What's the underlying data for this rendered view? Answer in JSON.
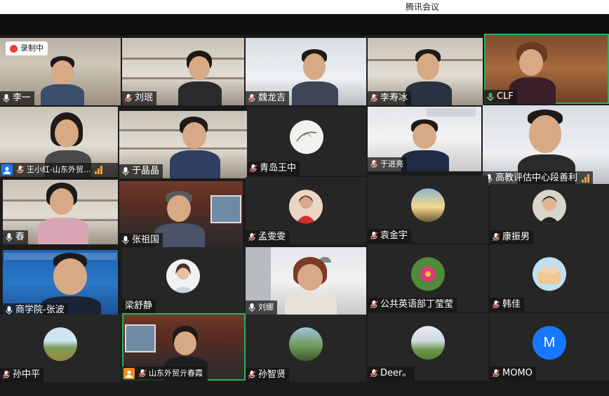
{
  "window": {
    "title": "腾讯会议"
  },
  "recording": {
    "label": "录制中"
  },
  "colors": {
    "active_border": "#2bb25a",
    "avatar_blue": "#1677ff",
    "record_red": "#e8403a",
    "signal": "#f0a030"
  },
  "participants": [
    {
      "name": "李一",
      "mic": "on"
    },
    {
      "name": "刘珉",
      "mic": "muted"
    },
    {
      "name": "魏龙吉",
      "mic": "muted"
    },
    {
      "name": "李寿冰",
      "mic": "muted"
    },
    {
      "name": "CLF",
      "mic": "on"
    },
    {
      "name": "王小红-山东外贸...",
      "mic": "muted"
    },
    {
      "name": "于晶晶",
      "mic": "on"
    },
    {
      "name": "青岛王中",
      "mic": "muted"
    },
    {
      "name": "于进亮",
      "mic": "muted"
    },
    {
      "name": "高教评估中心段善利",
      "mic": "on"
    },
    {
      "name": "春",
      "mic": "on"
    },
    {
      "name": "张祖国",
      "mic": "on"
    },
    {
      "name": "孟雯雯",
      "mic": "muted"
    },
    {
      "name": "袁金宇",
      "mic": "muted"
    },
    {
      "name": "康振男",
      "mic": "muted"
    },
    {
      "name": "商学院-张波",
      "mic": "on"
    },
    {
      "name": "梁舒静",
      "mic": "none"
    },
    {
      "name": "刘娜",
      "mic": "on"
    },
    {
      "name": "公共英语部丁莹莹",
      "mic": "muted"
    },
    {
      "name": "韩佳",
      "mic": "muted"
    },
    {
      "name": "孙中平",
      "mic": "muted"
    },
    {
      "name": "山东外贸亓春霞",
      "mic": "muted"
    },
    {
      "name": "孙智贤",
      "mic": "muted"
    },
    {
      "name": "Deer。",
      "mic": "muted"
    },
    {
      "name": "MOMO",
      "mic": "muted"
    }
  ],
  "avatar_letters": {
    "momo": "M"
  }
}
